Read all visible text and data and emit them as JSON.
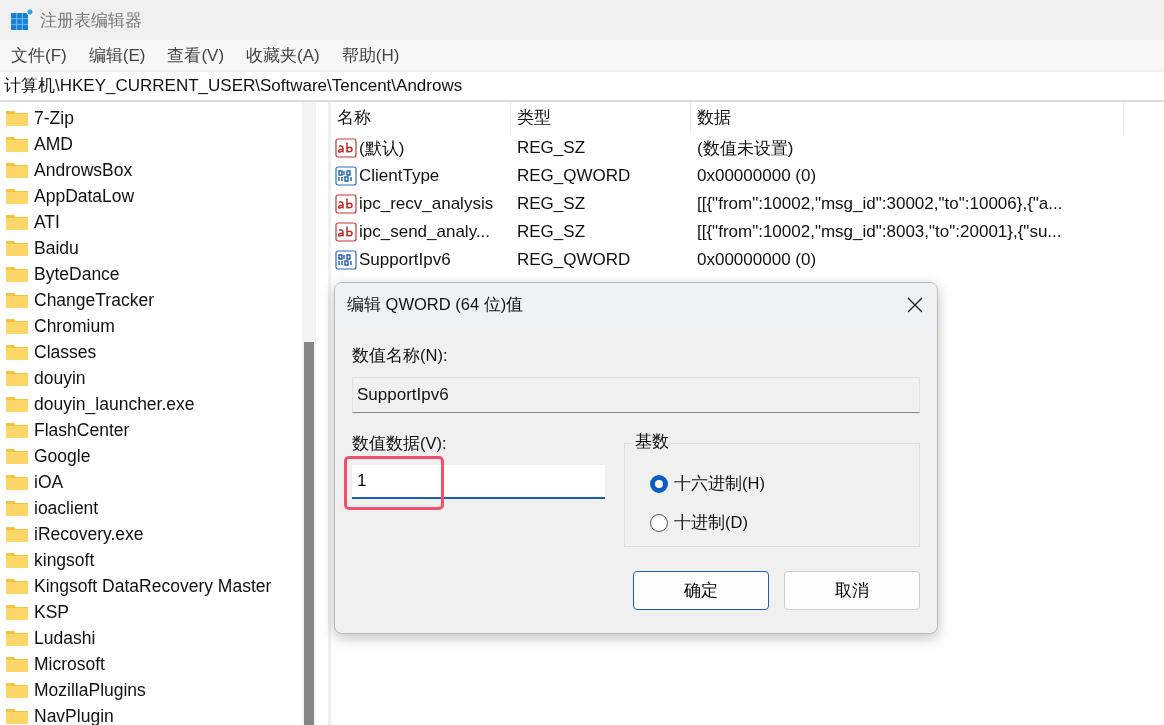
{
  "window": {
    "title": "注册表编辑器"
  },
  "menu": [
    "文件(F)",
    "编辑(E)",
    "查看(V)",
    "收藏夹(A)",
    "帮助(H)"
  ],
  "address": "计算机\\HKEY_CURRENT_USER\\Software\\Tencent\\Androws",
  "tree": {
    "items": [
      {
        "label": "7-Zip"
      },
      {
        "label": "AMD"
      },
      {
        "label": "AndrowsBox"
      },
      {
        "label": "AppDataLow"
      },
      {
        "label": "ATI"
      },
      {
        "label": "Baidu"
      },
      {
        "label": "ByteDance"
      },
      {
        "label": "ChangeTracker"
      },
      {
        "label": "Chromium"
      },
      {
        "label": "Classes"
      },
      {
        "label": "douyin"
      },
      {
        "label": "douyin_launcher.exe"
      },
      {
        "label": "FlashCenter"
      },
      {
        "label": "Google"
      },
      {
        "label": "iOA"
      },
      {
        "label": "ioaclient"
      },
      {
        "label": "iRecovery.exe"
      },
      {
        "label": "kingsoft"
      },
      {
        "label": "Kingsoft DataRecovery Master"
      },
      {
        "label": "KSP"
      },
      {
        "label": "Ludashi"
      },
      {
        "label": "Microsoft"
      },
      {
        "label": "MozillaPlugins"
      },
      {
        "label": "NavPlugin"
      }
    ]
  },
  "table": {
    "columns": [
      "名称",
      "类型",
      "数据"
    ],
    "rows": [
      {
        "kind": "string",
        "name": "(默认)",
        "type": "REG_SZ",
        "data": "(数值未设置)"
      },
      {
        "kind": "binary",
        "name": "ClientType",
        "type": "REG_QWORD",
        "data": "0x00000000 (0)"
      },
      {
        "kind": "string",
        "name": "ipc_recv_analysis",
        "type": "REG_SZ",
        "data": "[[{\"from\":10002,\"msg_id\":30002,\"to\":10006},{\"a..."
      },
      {
        "kind": "string",
        "name": "ipc_send_analy...",
        "type": "REG_SZ",
        "data": "[[{\"from\":10002,\"msg_id\":8003,\"to\":20001},{\"su..."
      },
      {
        "kind": "binary",
        "name": "SupportIpv6",
        "type": "REG_QWORD",
        "data": "0x00000000 (0)"
      }
    ]
  },
  "dialog": {
    "title": "编辑 QWORD (64 位)值",
    "name_label": "数值名称(N):",
    "name_value": "SupportIpv6",
    "data_label": "数值数据(V):",
    "data_value": "1",
    "highlighted": true,
    "base_label": "基数",
    "bases": [
      {
        "label": "十六进制(H)",
        "selected": true
      },
      {
        "label": "十进制(D)",
        "selected": false
      }
    ],
    "buttons": [
      "确定",
      "取消"
    ]
  }
}
